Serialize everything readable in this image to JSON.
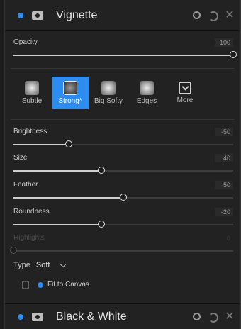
{
  "vignette_header": {
    "title": "Vignette"
  },
  "opacity": {
    "label": "Opacity",
    "value": "100",
    "fraction": 1.0
  },
  "presets": [
    {
      "label": "Subtle",
      "active": false
    },
    {
      "label": "Strong*",
      "active": true
    },
    {
      "label": "Big Softy",
      "active": false
    },
    {
      "label": "Edges",
      "active": false
    },
    {
      "label": "More",
      "active": false
    }
  ],
  "sliders": {
    "brightness": {
      "label": "Brightness",
      "value": "-50",
      "fraction": 0.25
    },
    "size": {
      "label": "Size",
      "value": "40",
      "fraction": 0.4
    },
    "feather": {
      "label": "Feather",
      "value": "50",
      "fraction": 0.5
    },
    "roundness": {
      "label": "Roundness",
      "value": "-20",
      "fraction": 0.4
    },
    "highlights": {
      "label": "Highlights",
      "value": "0",
      "fraction": 0.0
    }
  },
  "type_row": {
    "label": "Type",
    "value": "Soft"
  },
  "fit_row": {
    "label": "Fit to Canvas"
  },
  "bw_header": {
    "title": "Black & White"
  },
  "colors": {
    "accent": "#2d8cf0"
  }
}
